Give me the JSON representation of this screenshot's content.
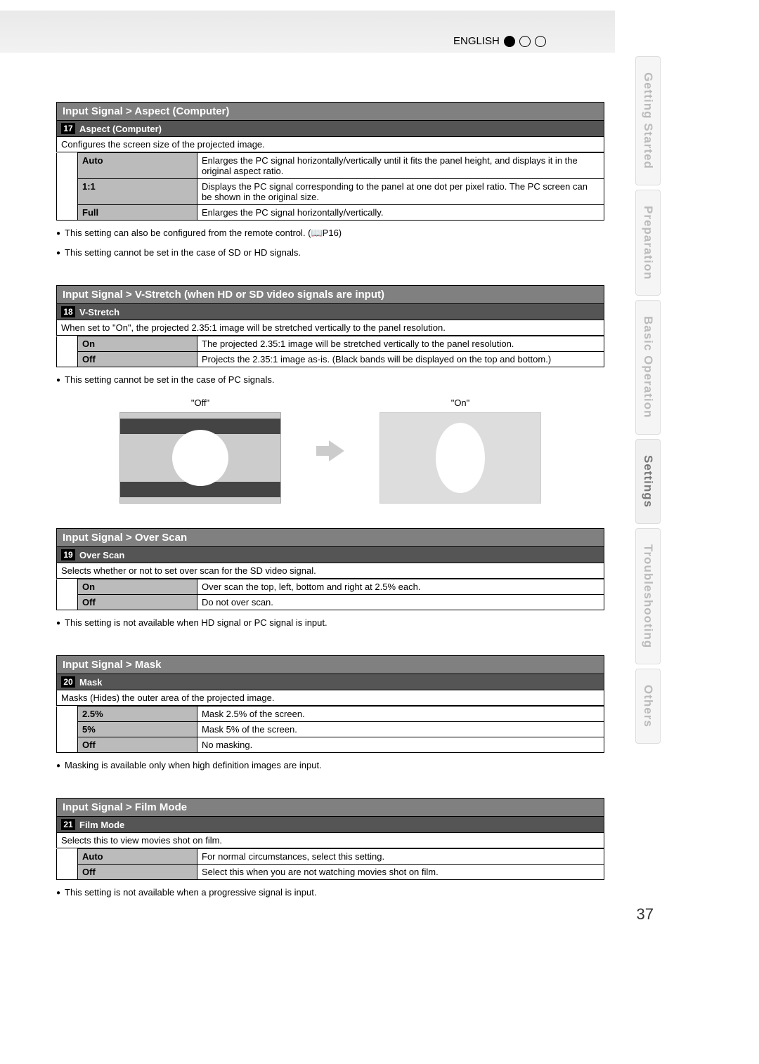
{
  "language": "ENGLISH",
  "page_number": "37",
  "side_tabs": [
    "Getting Started",
    "Preparation",
    "Basic Operation",
    "Settings",
    "Troubleshooting",
    "Others"
  ],
  "active_tab_index": 3,
  "sections": {
    "aspect": {
      "bar": "Input Signal > Aspect (Computer)",
      "num": "17",
      "title": "Aspect (Computer)",
      "desc": "Configures the screen size of the projected image.",
      "rows": [
        {
          "name": "Auto",
          "val": "Enlarges the PC signal horizontally/vertically until it fits the panel height, and displays it in the original aspect ratio."
        },
        {
          "name": "1:1",
          "val": "Displays the PC signal corresponding to the panel at one dot per pixel ratio. The PC screen can be shown in the original size."
        },
        {
          "name": "Full",
          "val": "Enlarges the PC signal horizontally/vertically."
        }
      ],
      "bullets": [
        "This setting can also be configured from the remote control. (📖P16)",
        "This setting cannot be set in the case of SD or HD signals."
      ]
    },
    "vstretch": {
      "bar": "Input Signal > V-Stretch (when HD or SD video signals are input)",
      "num": "18",
      "title": "V-Stretch",
      "desc": "When set to \"On\", the projected 2.35:1 image will be stretched vertically to the panel resolution.",
      "rows": [
        {
          "name": "On",
          "val": "The projected 2.35:1 image will be stretched vertically to the panel resolution."
        },
        {
          "name": "Off",
          "val": "Projects the 2.35:1 image as-is. (Black bands will be displayed on the top and bottom.)"
        }
      ],
      "bullets": [
        "This setting cannot be set in the case of PC signals."
      ],
      "fig_off": "\"Off\"",
      "fig_on": "\"On\""
    },
    "overscan": {
      "bar": "Input Signal > Over Scan",
      "num": "19",
      "title": "Over Scan",
      "desc": "Selects whether or not to set over scan for the SD video signal.",
      "rows": [
        {
          "name": "On",
          "val": "Over scan the top, left, bottom and right at 2.5% each."
        },
        {
          "name": "Off",
          "val": "Do not over scan."
        }
      ],
      "bullets": [
        "This setting is not available when HD signal or PC signal is input."
      ]
    },
    "mask": {
      "bar": "Input Signal > Mask",
      "num": "20",
      "title": "Mask",
      "desc": "Masks (Hides) the outer area of the projected image.",
      "rows": [
        {
          "name": "2.5%",
          "val": "Mask 2.5% of the screen."
        },
        {
          "name": "5%",
          "val": "Mask 5% of the screen."
        },
        {
          "name": "Off",
          "val": "No masking."
        }
      ],
      "bullets": [
        "Masking is available only when high definition images are input."
      ]
    },
    "film": {
      "bar": "Input Signal > Film Mode",
      "num": "21",
      "title": "Film Mode",
      "desc": "Selects this to view movies shot on film.",
      "rows": [
        {
          "name": "Auto",
          "val": "For normal circumstances, select this setting."
        },
        {
          "name": "Off",
          "val": "Select this when you are not watching movies shot on film."
        }
      ],
      "bullets": [
        "This setting is not available when a progressive signal is input."
      ]
    }
  }
}
